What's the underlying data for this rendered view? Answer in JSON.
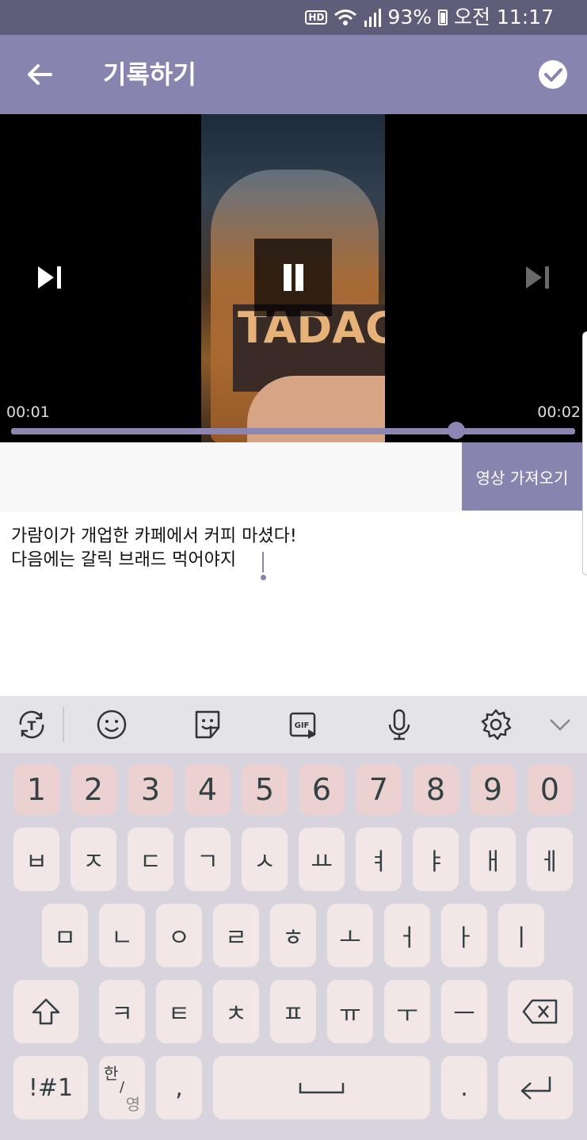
{
  "status": {
    "hd": "HD",
    "battery": "93%",
    "time": "오전 11:17"
  },
  "appbar": {
    "title": "기록하기"
  },
  "video": {
    "current_time": "00:01",
    "total_time": "00:02",
    "progress": 0.79,
    "frame_text": "TADAC"
  },
  "actions": {
    "import_video": "영상 가져오기"
  },
  "memo": {
    "line1": "가람이가 개업한  카페에서 커피 마셨다!",
    "line2": "다음에는 갈릭 브래드 먹어야지"
  },
  "keyboard": {
    "toolbar_icons": [
      "text-mode-icon",
      "emoji-icon",
      "sticker-icon",
      "gif-icon",
      "microphone-icon",
      "settings-icon",
      "chevron-down-icon"
    ],
    "row_numbers": [
      "1",
      "2",
      "3",
      "4",
      "5",
      "6",
      "7",
      "8",
      "9",
      "0"
    ],
    "row1": [
      "ㅂ",
      "ㅈ",
      "ㄷ",
      "ㄱ",
      "ㅅ",
      "ㅛ",
      "ㅕ",
      "ㅑ",
      "ㅐ",
      "ㅔ"
    ],
    "row2": [
      "ㅁ",
      "ㄴ",
      "ㅇ",
      "ㄹ",
      "ㅎ",
      "ㅗ",
      "ㅓ",
      "ㅏ",
      "ㅣ"
    ],
    "row3": [
      "ㅋ",
      "ㅌ",
      "ㅊ",
      "ㅍ",
      "ㅠ",
      "ㅜ",
      "ㅡ"
    ],
    "symbols_label": "!#1",
    "lang_top": "한",
    "lang_bottom": "영",
    "comma": ",",
    "period": "."
  },
  "colors": {
    "accent": "#8784b0",
    "statusbar": "#5f5d79",
    "number_key": "#ebd2d1",
    "letter_key": "#f2e6e6"
  }
}
